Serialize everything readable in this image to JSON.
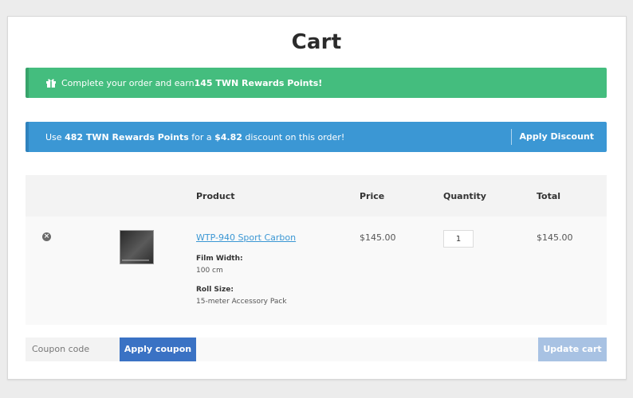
{
  "page": {
    "title": "Cart"
  },
  "rewards_banner": {
    "prefix": "Complete your order and earn ",
    "highlight": "145 TWN Rewards Points!",
    "icon": "gift-icon"
  },
  "discount_banner": {
    "prefix": "Use ",
    "points": "482 TWN Rewards Points",
    "middle": " for a ",
    "amount": "$4.82",
    "suffix": " discount on this order!",
    "action_label": "Apply Discount"
  },
  "table": {
    "headers": {
      "product": "Product",
      "price": "Price",
      "quantity": "Quantity",
      "total": "Total"
    },
    "rows": [
      {
        "remove_icon": "remove-circle-icon",
        "remove_symbol": "×",
        "product_name": "WTP-940 Sport Carbon",
        "meta": [
          {
            "label": "Film Width:",
            "value": "100 cm"
          },
          {
            "label": "Roll Size:",
            "value": "15-meter Accessory Pack"
          }
        ],
        "price": "$145.00",
        "quantity": "1",
        "total": "$145.00"
      }
    ]
  },
  "actions": {
    "coupon_placeholder": "Coupon code",
    "apply_coupon_label": "Apply coupon",
    "update_cart_label": "Update cart"
  },
  "colors": {
    "green_banner": "#44bd7e",
    "blue_banner": "#3b97d4",
    "primary_button": "#3a72c4",
    "disabled_button": "#a8c2e3",
    "link": "#3b97d4"
  }
}
